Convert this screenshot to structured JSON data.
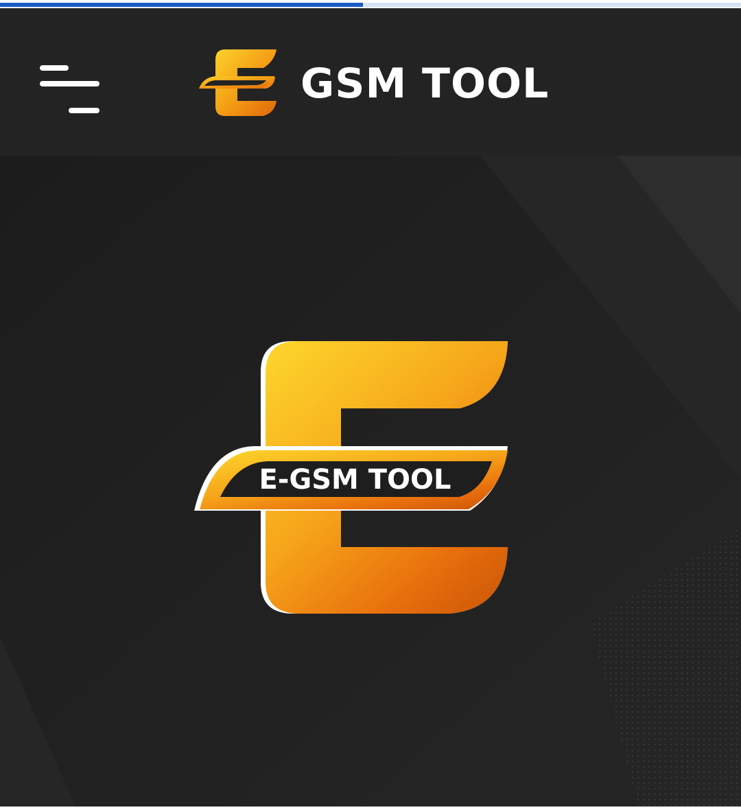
{
  "progress": {
    "fraction": 0.49,
    "fill_color": "#1a5bc4",
    "track_color": "#d6e2f5"
  },
  "header": {
    "menu_icon": "hamburger-menu-icon",
    "brand_icon": "e-letter-logo-icon",
    "brand_name": "GSM TOOL",
    "background": "#232323"
  },
  "hero": {
    "logo_icon": "e-gsm-tool-logo",
    "logo_text": "E-GSM TOOL",
    "accent_colors": [
      "#fcd22a",
      "#f39a14",
      "#e0690c"
    ],
    "background": "#1f1f1f"
  }
}
